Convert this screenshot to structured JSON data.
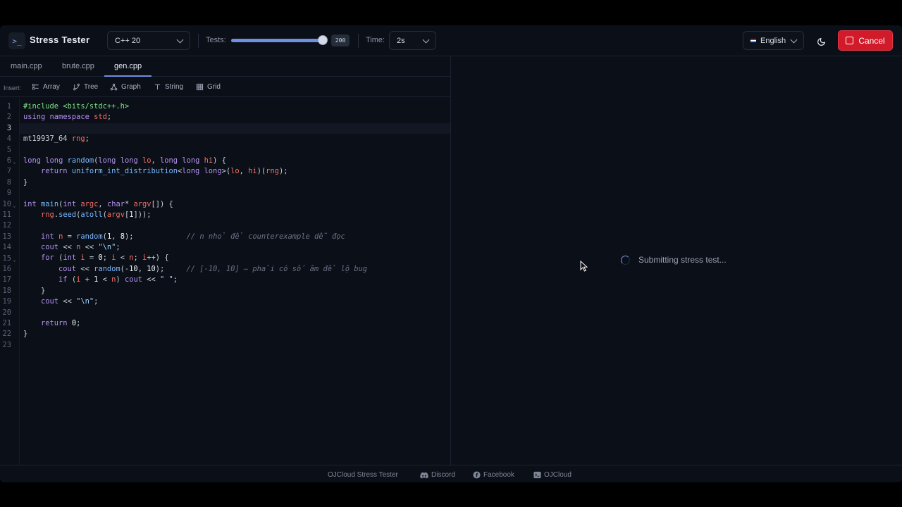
{
  "header": {
    "logo_glyph": ">_",
    "title": "Stress Tester",
    "language": "C++ 20",
    "tests_label": "Tests:",
    "tests_value": 200,
    "tests_max": 200,
    "tests_badge": "200",
    "time_label": "Time:",
    "time_value": "2s",
    "locale": "English",
    "cancel_label": "Cancel",
    "accent_color": "#6f8fe0",
    "cancel_color": "#d11a2a"
  },
  "tabs": [
    {
      "label": "main.cpp",
      "active": false
    },
    {
      "label": "brute.cpp",
      "active": false
    },
    {
      "label": "gen.cpp",
      "active": true
    }
  ],
  "insert": {
    "label": "Insert:",
    "items": [
      {
        "label": "Array",
        "icon": "list-icon"
      },
      {
        "label": "Tree",
        "icon": "git-branch-icon"
      },
      {
        "label": "Graph",
        "icon": "graph-icon"
      },
      {
        "label": "String",
        "icon": "type-icon"
      },
      {
        "label": "Grid",
        "icon": "grid-icon"
      }
    ]
  },
  "editor": {
    "current_line": 3,
    "line_numbers": [
      "1",
      "2",
      "3",
      "4",
      "5",
      "6",
      "7",
      "8",
      "9",
      "10",
      "11",
      "12",
      "13",
      "14",
      "15",
      "16",
      "17",
      "18",
      "19",
      "20",
      "21",
      "22",
      "23"
    ],
    "lines": [
      "#include <bits/stdc++.h>",
      "using namespace std;",
      "",
      "mt19937_64 rng;",
      "",
      "long long random(long long lo, long long hi) {",
      "    return uniform_int_distribution<long long>(lo, hi)(rng);",
      "}",
      "",
      "int main(int argc, char* argv[]) {",
      "    rng.seed(atoll(argv[1]));",
      "",
      "    int n = random(1, 8);            // n nhỏ để counterexample dễ đọc",
      "    cout << n << \"\\n\";",
      "    for (int i = 0; i < n; i++) {",
      "        cout << random(-10, 10);     // [-10, 10] — phải có số âm để lộ bug",
      "        if (i + 1 < n) cout << \" \";",
      "    }",
      "    cout << \"\\n\";",
      "",
      "    return 0;",
      "}",
      ""
    ]
  },
  "result": {
    "status_text": "Submitting stress test..."
  },
  "footer": {
    "app_name": "OJCloud Stress Tester",
    "discord": "Discord",
    "facebook": "Facebook",
    "ojcloud": "OJCloud"
  }
}
